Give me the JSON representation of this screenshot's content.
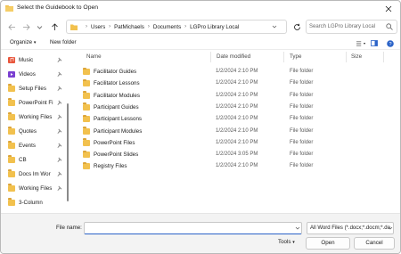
{
  "window": {
    "title": "Select the Guidebook to Open"
  },
  "breadcrumbs": [
    "Users",
    "PatMichaels",
    "Documents",
    "LGPro Library Local"
  ],
  "search": {
    "placeholder": "Search LGPro Library Local"
  },
  "toolbar": {
    "organize": "Organize",
    "new_folder": "New folder"
  },
  "sidebar": {
    "items": [
      {
        "label": "Music",
        "icon": "music-icon",
        "color": "#e8543a"
      },
      {
        "label": "Videos",
        "icon": "videos-icon",
        "color": "#7a3fd1"
      },
      {
        "label": "Setup Files",
        "icon": "folder-icon",
        "color": "#f2c14e"
      },
      {
        "label": "PowerPoint Fi",
        "icon": "folder-icon",
        "color": "#f2c14e"
      },
      {
        "label": "Working Files",
        "icon": "folder-icon",
        "color": "#f2c14e"
      },
      {
        "label": "Quotes",
        "icon": "folder-icon",
        "color": "#f2c14e"
      },
      {
        "label": "Events",
        "icon": "folder-icon",
        "color": "#f2c14e"
      },
      {
        "label": "CB",
        "icon": "folder-icon",
        "color": "#f2c14e"
      },
      {
        "label": "Docs Im Wor",
        "icon": "folder-icon",
        "color": "#f2c14e"
      },
      {
        "label": "Working Files",
        "icon": "folder-icon",
        "color": "#f2c14e"
      },
      {
        "label": "3-Column",
        "icon": "folder-icon",
        "color": "#f2c14e"
      }
    ]
  },
  "columns": {
    "name": "Name",
    "date": "Date modified",
    "type": "Type",
    "size": "Size"
  },
  "files": [
    {
      "name": "Facilitator Guides",
      "date": "1/2/2024 2:10 PM",
      "type": "File folder"
    },
    {
      "name": "Facilitator Lessons",
      "date": "1/2/2024 2:10 PM",
      "type": "File folder"
    },
    {
      "name": "Facilitator Modules",
      "date": "1/2/2024 2:10 PM",
      "type": "File folder"
    },
    {
      "name": "Participant Guides",
      "date": "1/2/2024 2:10 PM",
      "type": "File folder"
    },
    {
      "name": "Participant Lessons",
      "date": "1/2/2024 2:10 PM",
      "type": "File folder"
    },
    {
      "name": "Participant Modules",
      "date": "1/2/2024 2:10 PM",
      "type": "File folder"
    },
    {
      "name": "PowerPoint Files",
      "date": "1/2/2024 2:10 PM",
      "type": "File folder"
    },
    {
      "name": "PowerPoint Slides",
      "date": "1/2/2024 3:05 PM",
      "type": "File folder"
    },
    {
      "name": "Registry Files",
      "date": "1/2/2024 2:10 PM",
      "type": "File folder"
    }
  ],
  "bottom": {
    "file_name_label": "File name:",
    "file_name_value": "",
    "filter": "All Word Files (*.docx;*.docm;*.do",
    "tools": "Tools",
    "open": "Open",
    "cancel": "Cancel"
  },
  "colors": {
    "accent": "#2b63c8",
    "folder": "#f2c14e"
  }
}
